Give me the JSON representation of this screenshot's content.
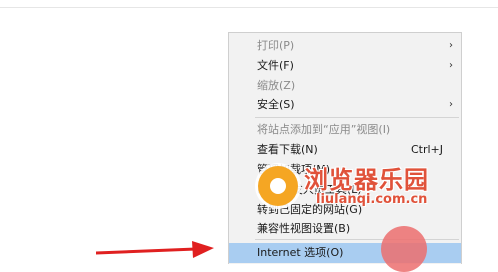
{
  "menu": {
    "items": [
      {
        "label": "打印(P)",
        "shortcut": "",
        "submenu": true,
        "enabled": false
      },
      {
        "label": "文件(F)",
        "shortcut": "",
        "submenu": true,
        "enabled": true
      },
      {
        "label": "缩放(Z)",
        "shortcut": "",
        "submenu": false,
        "enabled": false
      },
      {
        "label": "安全(S)",
        "shortcut": "",
        "submenu": true,
        "enabled": true
      },
      {
        "label": "将站点添加到“应用”视图(I)",
        "shortcut": "",
        "submenu": false,
        "enabled": false
      },
      {
        "label": "查看下载(N)",
        "shortcut": "Ctrl+J",
        "submenu": false,
        "enabled": true
      },
      {
        "label": "管理加载项(M)",
        "shortcut": "",
        "submenu": false,
        "enabled": true
      },
      {
        "label": "F12 开发人员工具(L)",
        "shortcut": "",
        "submenu": false,
        "enabled": true
      },
      {
        "label": "转到已固定的网站(G)",
        "shortcut": "",
        "submenu": false,
        "enabled": true
      },
      {
        "label": "兼容性视图设置(B)",
        "shortcut": "",
        "submenu": false,
        "enabled": true
      },
      {
        "label": "Internet 选项(O)",
        "shortcut": "",
        "submenu": false,
        "enabled": true,
        "highlighted": true
      }
    ]
  },
  "chevron_glyph": "›",
  "watermark": {
    "title": "浏览器乐园",
    "url": "liulanqi.com.cn"
  },
  "colors": {
    "menu_background": "#f2f2f2",
    "highlight": "#a9cdf1",
    "arrow": "#e02020",
    "click_marker": "#ec6e6e",
    "watermark": "#e0523a"
  }
}
